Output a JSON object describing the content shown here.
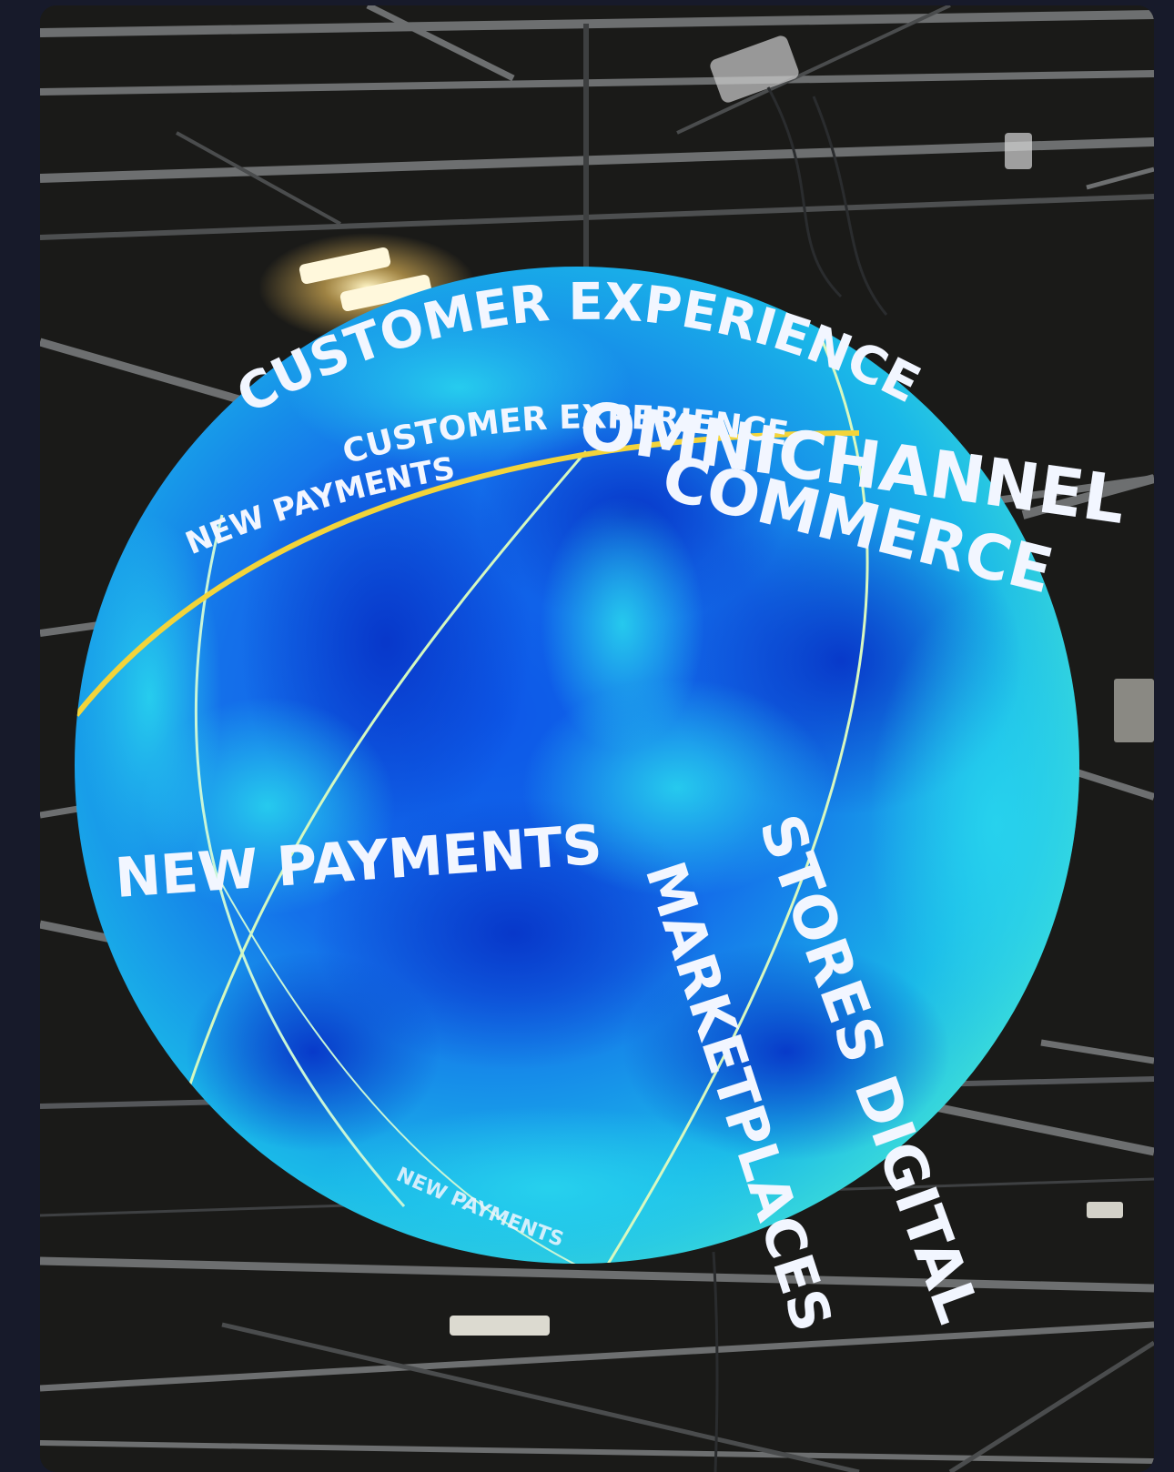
{
  "photo": {
    "description_kind": "led-sphere-display",
    "globe_texts": {
      "customer_experience_top": "CUSTOMER EXPERIENCE",
      "new_payments_small": "NEW PAYMENTS",
      "customer_experience_mid": "CUSTOMER EXPERIENCE",
      "omnichannel": "OMNICHANNEL",
      "commerce": "COMMERCE",
      "new_payments_large": "NEW PAYMENTS",
      "stores_digital": "STORES DIGITAL",
      "marketplaces": "MARKETPLACES",
      "new_payments_bottom": "NEW PAYMENTS"
    },
    "colors": {
      "background": "#171a2a",
      "sphere_deep_blue": "#0a3fd6",
      "sphere_cyan": "#1ec9e8",
      "accent_yellow": "#f3d43a",
      "ceiling": "#1c1c1a",
      "truss": "#6d6f70"
    }
  }
}
